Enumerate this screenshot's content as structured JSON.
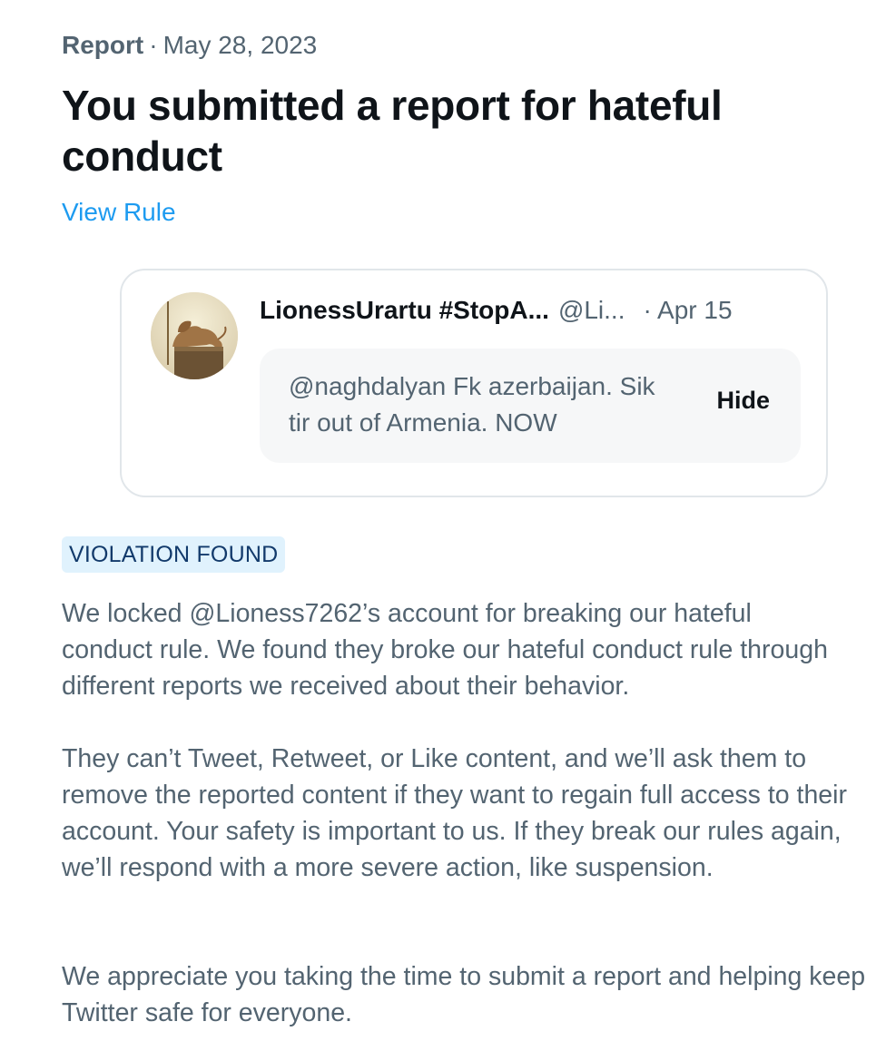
{
  "header": {
    "kind": "Report",
    "separator": "·",
    "date": "May 28, 2023",
    "title": "You submitted a report for hateful conduct",
    "view_rule_label": "View Rule"
  },
  "reported_tweet": {
    "display_name": "LionessUrartu #StopA...",
    "handle": "@Li...",
    "date": "· Apr 15",
    "text": "@naghdalyan Fk azerbaijan. Sik tir out of Armenia. NOW",
    "hide_label": "Hide",
    "avatar_icon": "lion-statue-avatar"
  },
  "status": {
    "badge": "VIOLATION FOUND",
    "badge_bg": "#e0f2fd",
    "badge_color": "#123a6b"
  },
  "paragraphs": [
    "We locked @Lioness7262’s account for breaking our hateful conduct rule. We found they broke our hateful conduct rule through different reports we received about their behavior.",
    "They can’t Tweet, Retweet, or Like content, and we’ll ask them to remove the reported content if they want to regain full access to their account. Your safety is important to us. If they break our rules again, we’ll respond with a more severe action, like suspension.",
    "We appreciate you taking the time to submit a report and helping keep Twitter safe for everyone."
  ],
  "colors": {
    "link": "#1d9bf0",
    "secondary_text": "#536471",
    "primary_text": "#0f1419"
  }
}
